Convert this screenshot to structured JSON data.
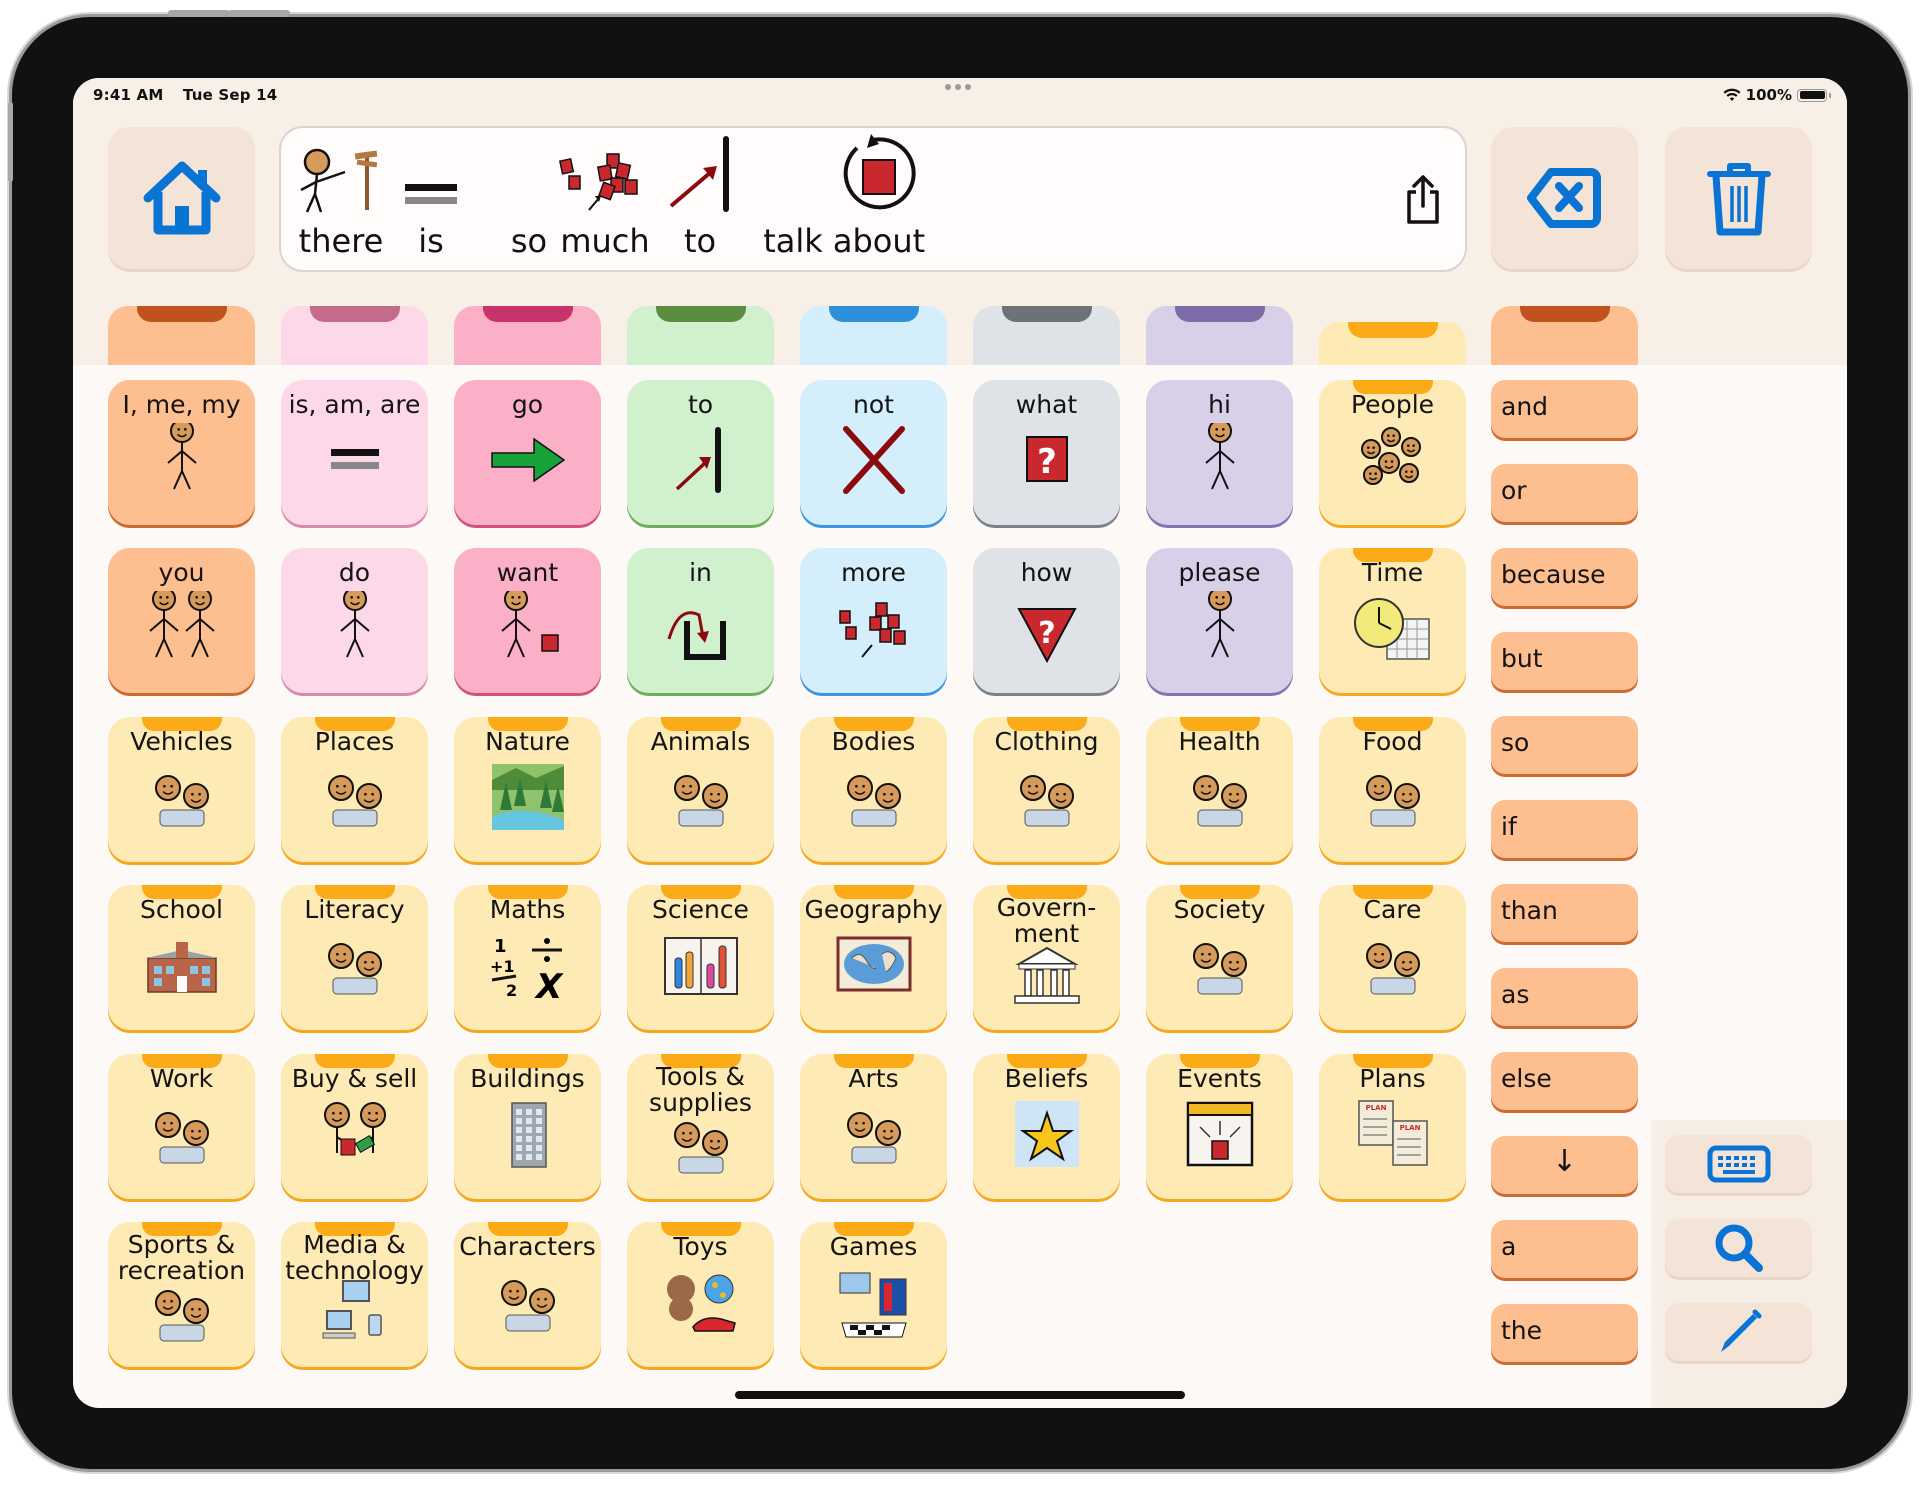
{
  "status_bar": {
    "time": "9:41 AM",
    "date": "Tue Sep 14",
    "battery": "100%"
  },
  "toolbar": {
    "home_icon": "home-icon",
    "share_icon": "share-icon",
    "delete_icon": "backspace-icon",
    "clear_icon": "trash-icon"
  },
  "sentence": {
    "words": [
      {
        "text": "there",
        "symbol": "person-pointing-signpost"
      },
      {
        "text": "is",
        "symbol": "equals"
      },
      {
        "text": "so",
        "symbol": ""
      },
      {
        "text": "much",
        "symbol": "many-red-squares"
      },
      {
        "text": "to",
        "symbol": "arrow-to-line"
      },
      {
        "text": "talk",
        "symbol": ""
      },
      {
        "text": "about",
        "symbol": "circle-around-square"
      }
    ]
  },
  "colors": {
    "accent_blue": "#0a74d4",
    "pronoun": "#fdbe90",
    "verb_light": "#fdd8e9",
    "verb": "#fcb0c8",
    "preposition": "#d0f0ce",
    "adverb": "#d4effb",
    "question": "#dfe2e6",
    "social": "#d8d0e8",
    "folder": "#feeab4",
    "folder_tab": "#fbaa18"
  },
  "category_tabs": [
    {
      "name": "pronouns",
      "bg": "#fdbe90",
      "notch": "#c0521d"
    },
    {
      "name": "verbs-be",
      "bg": "#fdd8e9",
      "notch": "#c46b8c"
    },
    {
      "name": "verbs",
      "bg": "#fcb0c8",
      "notch": "#c7336b"
    },
    {
      "name": "prepositions",
      "bg": "#d0f0ce",
      "notch": "#5b8d3e"
    },
    {
      "name": "adverbs",
      "bg": "#d4effb",
      "notch": "#2e8fdb"
    },
    {
      "name": "questions",
      "bg": "#dfe2e6",
      "notch": "#6d7178"
    },
    {
      "name": "social",
      "bg": "#d8d0e8",
      "notch": "#7c6ca8"
    },
    {
      "name": "folders",
      "bg": "#feeab4",
      "notch": "#fbaa18"
    },
    {
      "name": "conjunctions",
      "bg": "#fdbe90",
      "notch": "#c0521d"
    }
  ],
  "grid": {
    "rows": [
      [
        {
          "label": "I, me, my",
          "icon": "person-pointing-self-icon",
          "kind": "pronoun"
        },
        {
          "label": "is, am, are",
          "icon": "equals-icon",
          "kind": "verb_light"
        },
        {
          "label": "go",
          "icon": "green-arrow-icon",
          "kind": "verb"
        },
        {
          "label": "to",
          "icon": "arrow-to-line-icon",
          "kind": "preposition"
        },
        {
          "label": "not",
          "icon": "red-x-icon",
          "kind": "adverb"
        },
        {
          "label": "what",
          "icon": "question-square-icon",
          "kind": "question"
        },
        {
          "label": "hi",
          "icon": "person-waving-icon",
          "kind": "social"
        },
        {
          "label": "People",
          "icon": "people-faces-icon",
          "kind": "folder"
        }
      ],
      [
        {
          "label": "you",
          "icon": "two-people-pointing-icon",
          "kind": "pronoun"
        },
        {
          "label": "do",
          "icon": "person-reaching-icon",
          "kind": "verb_light"
        },
        {
          "label": "want",
          "icon": "person-wanting-box-icon",
          "kind": "verb"
        },
        {
          "label": "in",
          "icon": "arrow-into-box-icon",
          "kind": "preposition"
        },
        {
          "label": "more",
          "icon": "many-red-squares-icon",
          "kind": "adverb"
        },
        {
          "label": "how",
          "icon": "question-triangle-icon",
          "kind": "question"
        },
        {
          "label": "please",
          "icon": "person-please-icon",
          "kind": "social"
        },
        {
          "label": "Time",
          "icon": "clock-calendar-icon",
          "kind": "folder"
        }
      ],
      [
        {
          "label": "Vehicles",
          "icon": "vehicles-icon",
          "kind": "folder"
        },
        {
          "label": "Places",
          "icon": "maps-icon",
          "kind": "folder"
        },
        {
          "label": "Nature",
          "icon": "forest-landscape-icon",
          "kind": "folder"
        },
        {
          "label": "Animals",
          "icon": "animals-icon",
          "kind": "folder"
        },
        {
          "label": "Bodies",
          "icon": "anatomy-icon",
          "kind": "folder"
        },
        {
          "label": "Clothing",
          "icon": "clothing-icon",
          "kind": "folder"
        },
        {
          "label": "Health",
          "icon": "health-icon",
          "kind": "folder"
        },
        {
          "label": "Food",
          "icon": "food-icon",
          "kind": "folder"
        }
      ],
      [
        {
          "label": "School",
          "icon": "school-building-icon",
          "kind": "folder"
        },
        {
          "label": "Literacy",
          "icon": "reading-writing-icon",
          "kind": "folder"
        },
        {
          "label": "Maths",
          "icon": "math-symbols-icon",
          "kind": "folder"
        },
        {
          "label": "Science",
          "icon": "test-tubes-book-icon",
          "kind": "folder"
        },
        {
          "label": "Geography",
          "icon": "world-map-book-icon",
          "kind": "folder"
        },
        {
          "label": "Govern-\nment",
          "icon": "government-building-icon",
          "kind": "folder"
        },
        {
          "label": "Society",
          "icon": "community-icon",
          "kind": "folder"
        },
        {
          "label": "Care",
          "icon": "care-icon",
          "kind": "folder"
        }
      ],
      [
        {
          "label": "Work",
          "icon": "workers-icon",
          "kind": "folder"
        },
        {
          "label": "Buy & sell",
          "icon": "trade-icon",
          "kind": "folder"
        },
        {
          "label": "Buildings",
          "icon": "office-building-icon",
          "kind": "folder"
        },
        {
          "label": "Tools &\nsupplies",
          "icon": "tools-icon",
          "kind": "folder"
        },
        {
          "label": "Arts",
          "icon": "arts-icon",
          "kind": "folder"
        },
        {
          "label": "Beliefs",
          "icon": "star-sky-icon",
          "kind": "folder"
        },
        {
          "label": "Events",
          "icon": "event-calendar-icon",
          "kind": "folder"
        },
        {
          "label": "Plans",
          "icon": "plan-documents-icon",
          "kind": "folder"
        }
      ],
      [
        {
          "label": "Sports &\nrecreation",
          "icon": "sports-icon",
          "kind": "folder"
        },
        {
          "label": "Media &\ntechnology",
          "icon": "computer-devices-icon",
          "kind": "folder"
        },
        {
          "label": "Characters",
          "icon": "characters-icon",
          "kind": "folder"
        },
        {
          "label": "Toys",
          "icon": "toys-icon",
          "kind": "folder"
        },
        {
          "label": "Games",
          "icon": "games-icon",
          "kind": "folder"
        }
      ]
    ]
  },
  "conjunctions": [
    "and",
    "or",
    "because",
    "but",
    "so",
    "if",
    "than",
    "as",
    "else",
    "↓",
    "a",
    "the"
  ],
  "tools": {
    "keyboard": "keyboard-icon",
    "search": "search-icon",
    "edit": "pencil-icon"
  }
}
